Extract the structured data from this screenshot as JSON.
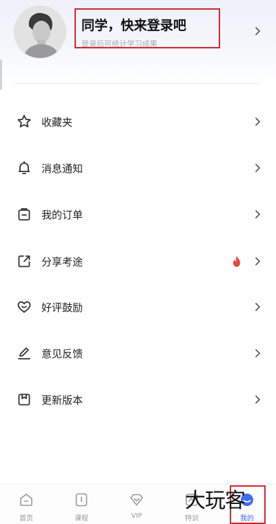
{
  "profile": {
    "title": "同学，快来登录吧",
    "subtitle": "登录后可统计学习成果"
  },
  "menu": [
    {
      "label": "收藏夹",
      "icon": "star-icon"
    },
    {
      "label": "消息通知",
      "icon": "bell-icon"
    },
    {
      "label": "我的订单",
      "icon": "order-bag-icon"
    },
    {
      "label": "分享考途",
      "icon": "share-icon",
      "badge": "fire-icon"
    },
    {
      "label": "好评鼓励",
      "icon": "heart-icon"
    },
    {
      "label": "意见反馈",
      "icon": "edit-pen-icon"
    },
    {
      "label": "更新版本",
      "icon": "bookmark-icon"
    }
  ],
  "tabbar": [
    {
      "label": "首页",
      "icon": "home-icon"
    },
    {
      "label": "课程",
      "icon": "course-icon"
    },
    {
      "label": "VIP",
      "icon": "vip-diamond-icon"
    },
    {
      "label": "特训",
      "icon": "training-icon"
    },
    {
      "label": "我的",
      "icon": "profile-icon",
      "active": true
    }
  ],
  "watermark": "大玩客",
  "colors": {
    "highlight_box": "#d0262e",
    "fire": "#e8463a",
    "active_tab": "#3d6df2"
  }
}
